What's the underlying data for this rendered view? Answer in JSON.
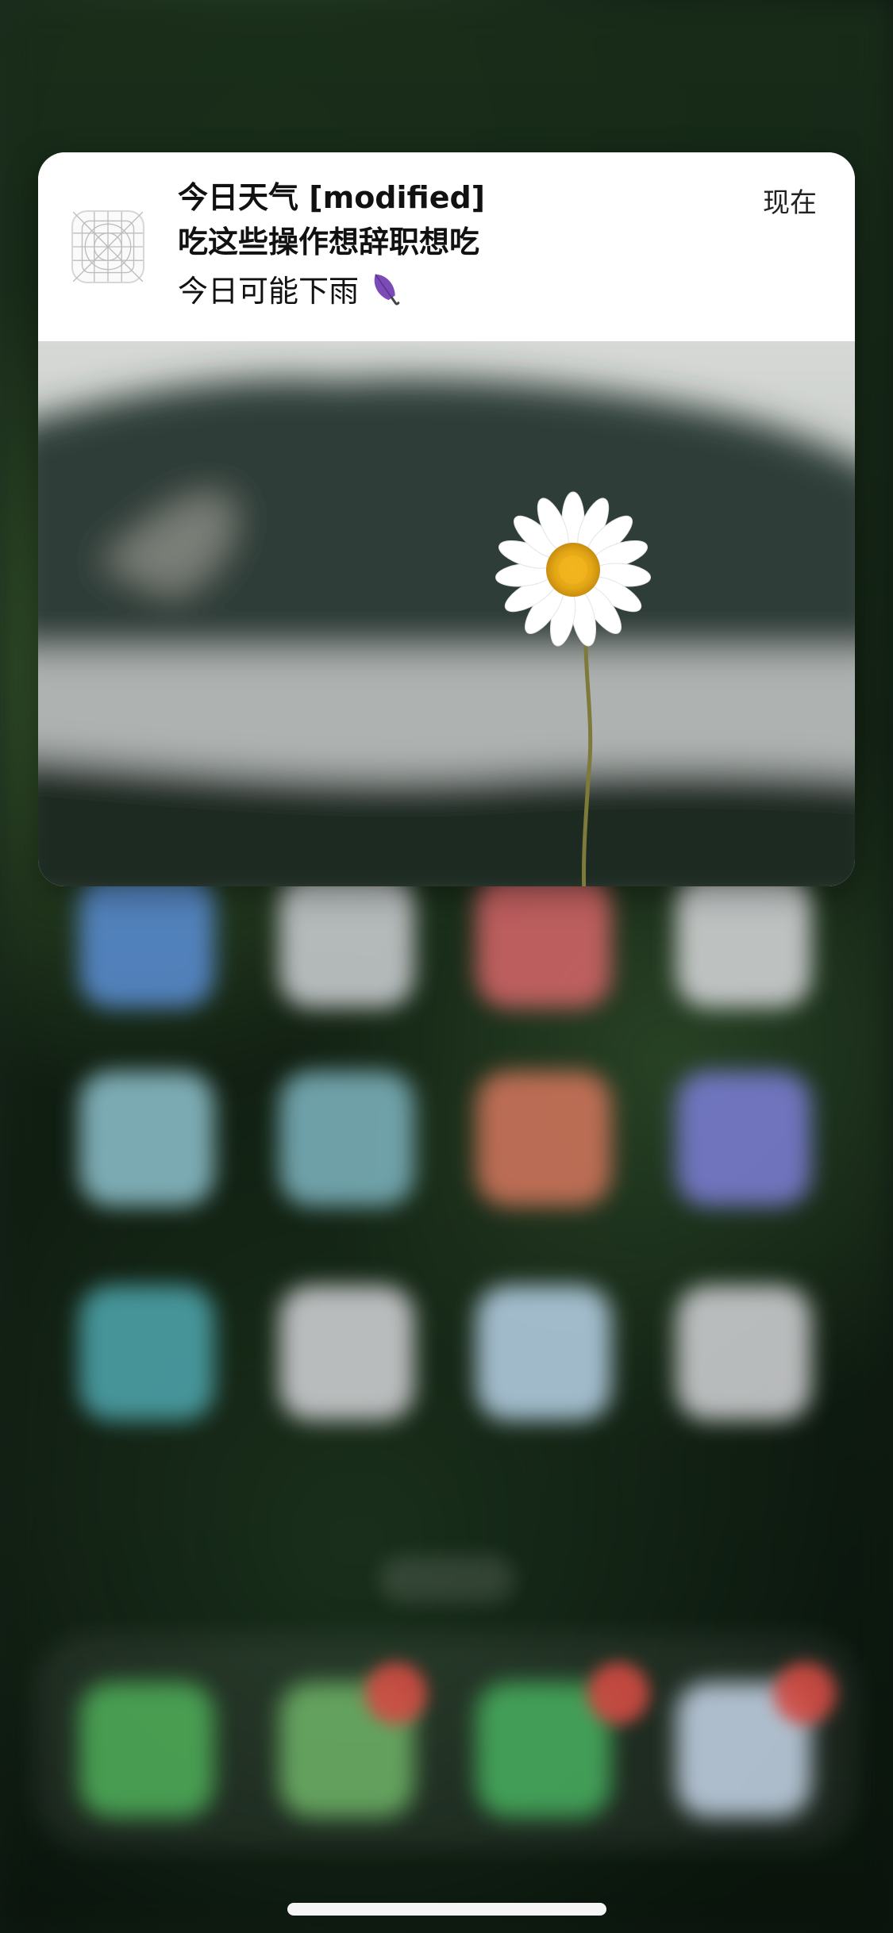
{
  "notification": {
    "app_icon": "app-placeholder-grid-icon",
    "title": "今日天气 [modified]",
    "subtitle": "吃这些操作想辞职想吃",
    "body": "今日可能下雨",
    "body_emoji_icon": "umbrella-icon",
    "time": "现在",
    "attachment": "daisy-photo-image"
  },
  "home_screen": {
    "rows": 3,
    "columns": 4,
    "dock_apps": 4,
    "colors": {
      "app_blue": "#5b8fd6",
      "app_red": "#d8666a",
      "app_teal": "#7fb6c2",
      "app_purple": "#7d7fd8",
      "app_green": "#4fb05a",
      "badge": "#d24b43"
    }
  }
}
